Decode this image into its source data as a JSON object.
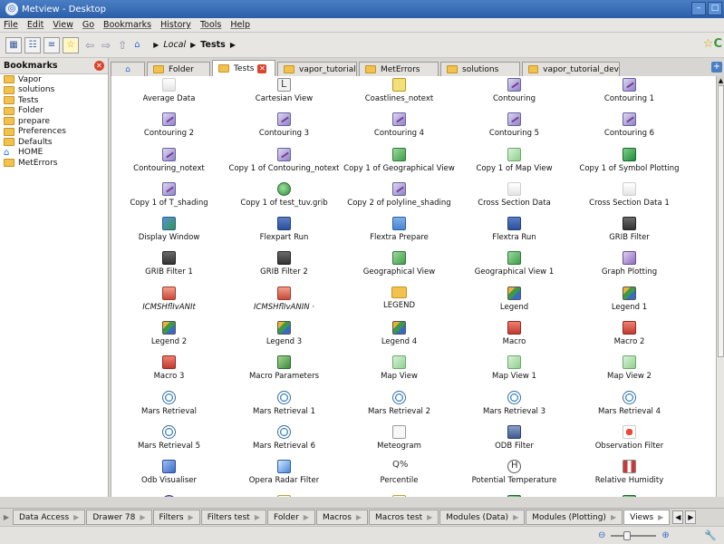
{
  "window": {
    "title": "Metview - Desktop"
  },
  "menu": [
    "File",
    "Edit",
    "View",
    "Go",
    "Bookmarks",
    "History",
    "Tools",
    "Help"
  ],
  "breadcrumb": {
    "local": "Local",
    "current": "Tests"
  },
  "bookmarks": {
    "title": "Bookmarks",
    "items": [
      {
        "label": "Vapor",
        "icon": "folder-icon"
      },
      {
        "label": "solutions",
        "icon": "folder-icon"
      },
      {
        "label": "Tests",
        "icon": "folder-icon"
      },
      {
        "label": "Folder",
        "icon": "folder-icon"
      },
      {
        "label": "prepare",
        "icon": "folder-icon"
      },
      {
        "label": "Preferences",
        "icon": "folder-icon"
      },
      {
        "label": "Defaults",
        "icon": "folder-icon"
      },
      {
        "label": "HOME",
        "icon": "home-icon"
      },
      {
        "label": "MetErrors",
        "icon": "folder-icon"
      }
    ]
  },
  "tabs": [
    {
      "label": "Folder"
    },
    {
      "label": "Tests",
      "active": true
    },
    {
      "label": "vapor_tutorial"
    },
    {
      "label": "MetErrors"
    },
    {
      "label": "solutions"
    },
    {
      "label": "vapor_tutorial_dev"
    }
  ],
  "icons": [
    {
      "label": "Average Data",
      "type": "cross"
    },
    {
      "label": "Cartesian View",
      "type": "view"
    },
    {
      "label": "Coastlines_notext",
      "type": "coast"
    },
    {
      "label": "Contouring",
      "type": "plot"
    },
    {
      "label": "Contouring 1",
      "type": "plot"
    },
    {
      "label": "Contouring 2",
      "type": "plot"
    },
    {
      "label": "Contouring 3",
      "type": "plot"
    },
    {
      "label": "Contouring 4",
      "type": "plot"
    },
    {
      "label": "Contouring 5",
      "type": "plot"
    },
    {
      "label": "Contouring 6",
      "type": "plot"
    },
    {
      "label": "Contouring_notext",
      "type": "plot"
    },
    {
      "label": "Copy 1 of Contouring_notext",
      "type": "plot"
    },
    {
      "label": "Copy 1 of Geographical View",
      "type": "geo"
    },
    {
      "label": "Copy 1 of Map View",
      "type": "map"
    },
    {
      "label": "Copy 1 of Symbol Plotting",
      "type": "green"
    },
    {
      "label": "Copy 1 of T_shading",
      "type": "plot"
    },
    {
      "label": "Copy 1 of test_tuv.grib",
      "type": "globe"
    },
    {
      "label": "Copy 2 of polyline_shading",
      "type": "plot"
    },
    {
      "label": "Cross Section Data",
      "type": "cross"
    },
    {
      "label": "Cross Section Data 1",
      "type": "cross"
    },
    {
      "label": "Display Window",
      "type": "disp"
    },
    {
      "label": "Flexpart Run",
      "type": "flex"
    },
    {
      "label": "Flextra Prepare",
      "type": "prep"
    },
    {
      "label": "Flextra Run",
      "type": "flex"
    },
    {
      "label": "GRIB Filter",
      "type": "grib"
    },
    {
      "label": "GRIB Filter 1",
      "type": "grib"
    },
    {
      "label": "GRIB Filter 2",
      "type": "grib"
    },
    {
      "label": "Geographical View",
      "type": "geo"
    },
    {
      "label": "Geographical View 1",
      "type": "geo"
    },
    {
      "label": "Graph Plotting",
      "type": "graph"
    },
    {
      "label": "ICMSHflIvANIt",
      "type": "icm",
      "italic": true
    },
    {
      "label": "ICMSHflIvANIN ·",
      "type": "icm",
      "italic": true
    },
    {
      "label": "LEGEND",
      "type": "folderico"
    },
    {
      "label": "Legend",
      "type": "legend"
    },
    {
      "label": "Legend 1",
      "type": "legend"
    },
    {
      "label": "Legend 2",
      "type": "legend"
    },
    {
      "label": "Legend 3",
      "type": "legend"
    },
    {
      "label": "Legend 4",
      "type": "legend"
    },
    {
      "label": "Macro",
      "type": "macro"
    },
    {
      "label": "Macro 2",
      "type": "macro"
    },
    {
      "label": "Macro 3",
      "type": "macro"
    },
    {
      "label": "Macro Parameters",
      "type": "mparam"
    },
    {
      "label": "Map View",
      "type": "map"
    },
    {
      "label": "Map View 1",
      "type": "map"
    },
    {
      "label": "Map View 2",
      "type": "map"
    },
    {
      "label": "Mars Retrieval",
      "type": "mars"
    },
    {
      "label": "Mars Retrieval 1",
      "type": "mars"
    },
    {
      "label": "Mars Retrieval 2",
      "type": "mars"
    },
    {
      "label": "Mars Retrieval 3",
      "type": "mars"
    },
    {
      "label": "Mars Retrieval 4",
      "type": "mars"
    },
    {
      "label": "Mars Retrieval 5",
      "type": "mars"
    },
    {
      "label": "Mars Retrieval 6",
      "type": "mars"
    },
    {
      "label": "Meteogram",
      "type": "meteo"
    },
    {
      "label": "ODB Filter",
      "type": "odb"
    },
    {
      "label": "Observation Filter",
      "type": "obs"
    },
    {
      "label": "Odb Visualiser",
      "type": "odbv"
    },
    {
      "label": "Opera Radar Filter",
      "type": "radar"
    },
    {
      "label": "Percentile",
      "type": "pct"
    },
    {
      "label": "Potential Temperature",
      "type": "ptemp"
    },
    {
      "label": "Relative Humidity",
      "type": "rh"
    },
    {
      "label": "",
      "type": "shell"
    },
    {
      "label": "",
      "type": "table"
    },
    {
      "label": "",
      "type": "table"
    },
    {
      "label": "",
      "type": "green"
    },
    {
      "label": "",
      "type": "green"
    }
  ],
  "bottom_tabs": [
    {
      "label": "Data Access"
    },
    {
      "label": "Drawer 78"
    },
    {
      "label": "Filters"
    },
    {
      "label": "Filters test"
    },
    {
      "label": "Folder"
    },
    {
      "label": "Macros"
    },
    {
      "label": "Macros test"
    },
    {
      "label": "Modules (Data)"
    },
    {
      "label": "Modules (Plotting)"
    },
    {
      "label": "Views",
      "active": true
    }
  ]
}
